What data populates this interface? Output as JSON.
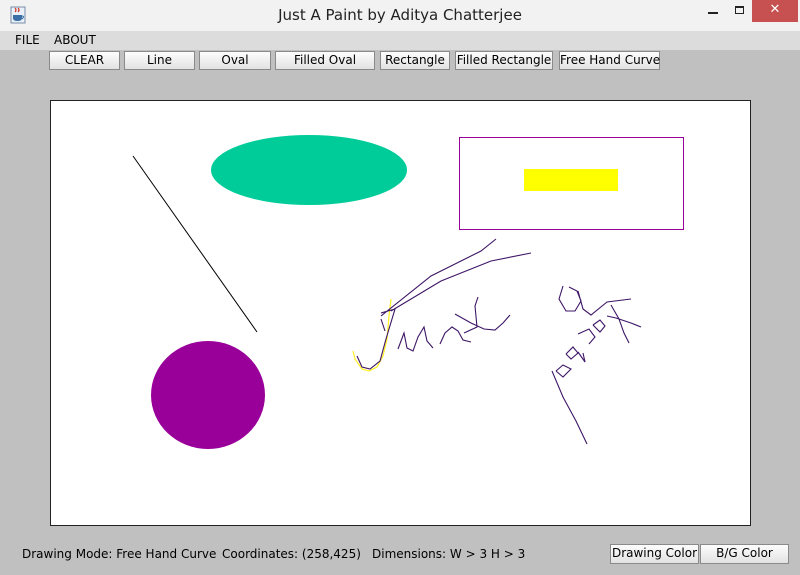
{
  "window": {
    "title": "Just A Paint by Aditya Chatterjee",
    "close_glyph": "✕",
    "icons": {
      "app": "java-cup-icon",
      "minimize": "minimize-icon",
      "maximize": "maximize-icon",
      "close": "close-icon"
    }
  },
  "menu": {
    "items": [
      {
        "label": "FILE"
      },
      {
        "label": "ABOUT"
      }
    ]
  },
  "toolbar": {
    "buttons": [
      {
        "label": "CLEAR"
      },
      {
        "label": "Line"
      },
      {
        "label": "Oval"
      },
      {
        "label": "Filled Oval"
      },
      {
        "label": "Rectangle"
      },
      {
        "label": "Filled Rectangle"
      },
      {
        "label": "Free Hand Curve"
      }
    ]
  },
  "canvas": {
    "background": "#ffffff",
    "colors": {
      "line": "#000000",
      "filled_oval_teal": "#00cc99",
      "filled_oval_purple": "#990099",
      "rectangle_outline": "#990099",
      "filled_rectangle": "#ffff00",
      "freehand_purple": "#3d1566",
      "freehand_yellow": "#ffee22"
    }
  },
  "status": {
    "drawing_mode": "Drawing Mode: Free Hand Curve",
    "coordinates": "Coordinates: (258,425)",
    "dimensions": "Dimensions: W > 3 H > 3"
  },
  "bottom_buttons": {
    "drawing_color": "Drawing Color",
    "bg_color": "B/G Color"
  }
}
